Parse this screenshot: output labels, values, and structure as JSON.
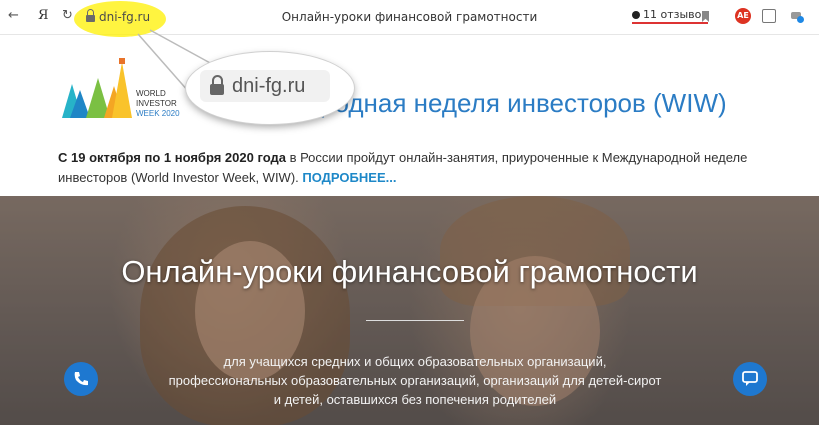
{
  "browser": {
    "back_label": "←",
    "yandex_label": "Я",
    "reload_label": "↻",
    "address": "dni-fg.ru",
    "tab_title": "Онлайн-уроки финансовой грамотности",
    "reviews_label": "11 отзывов",
    "ext_label": "AE"
  },
  "callout": {
    "url": "dni-fg.ru"
  },
  "logo": {
    "line1": "WORLD",
    "line2": "INVESTOR",
    "line3": "WEEK 2020"
  },
  "page": {
    "heading": "родная неделя инвесторов (WIW)",
    "desc_bold": "С 19 октября по 1 ноября 2020 года",
    "desc_text": " в России пройдут онлайн-занятия, приуроченные к Международной неделе инвесторов (World Investor Week, WIW). ",
    "more_link": "ПОДРОБНЕЕ..."
  },
  "hero": {
    "title": "Онлайн-уроки финансовой грамотности",
    "subtitle_line1": "для учащихся средних и общих образовательных организаций,",
    "subtitle_line2": "профессиональных образовательных организаций, организаций для детей-сирот",
    "subtitle_line3": "и детей, оставшихся без попечения родителей"
  },
  "colors": {
    "accent": "#2b7cc4",
    "highlight": "#fff000",
    "button": "#1e78d0"
  }
}
